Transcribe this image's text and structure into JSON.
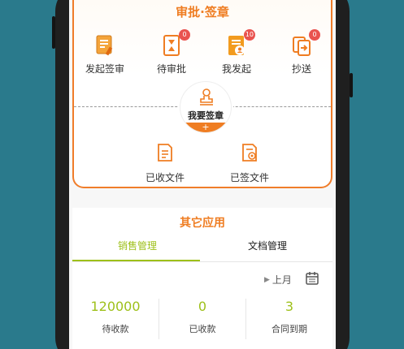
{
  "approval": {
    "title": "审批·签章",
    "items": [
      {
        "label": "发起签审",
        "icon": "document-pen-icon",
        "badge": ""
      },
      {
        "label": "待审批",
        "icon": "hourglass-document-icon",
        "badge": "0"
      },
      {
        "label": "我发起",
        "icon": "document-user-icon",
        "badge": "10"
      },
      {
        "label": "抄送",
        "icon": "copy-forward-icon",
        "badge": "0"
      }
    ],
    "sign_button": {
      "label": "我要签章",
      "plus": "+"
    },
    "files": [
      {
        "label": "已收文件",
        "icon": "received-file-icon"
      },
      {
        "label": "已签文件",
        "icon": "signed-file-icon"
      }
    ]
  },
  "other_apps": {
    "title": "其它应用",
    "tabs": [
      {
        "label": "销售管理",
        "active": true
      },
      {
        "label": "文档管理",
        "active": false
      }
    ],
    "period": {
      "arrow": "▶",
      "label": "上月"
    },
    "stats": [
      {
        "value": "120000",
        "label": "待收款"
      },
      {
        "value": "0",
        "label": "已收款"
      },
      {
        "value": "3",
        "label": "合同到期"
      }
    ]
  },
  "colors": {
    "accent": "#ef7d22",
    "green": "#9ec01a",
    "badge": "#e9534f"
  }
}
